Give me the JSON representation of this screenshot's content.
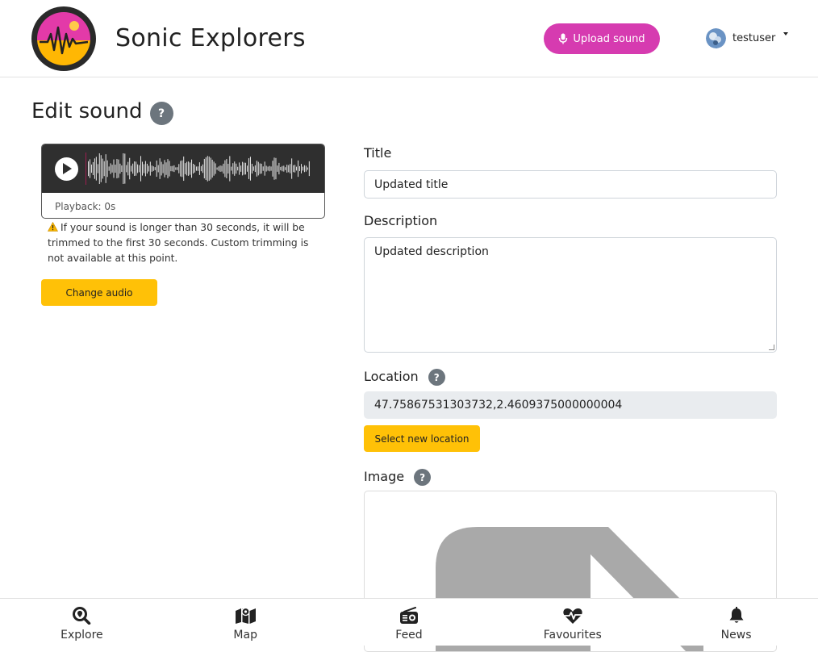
{
  "header": {
    "app_title": "Sonic Explorers",
    "upload_label": "Upload sound",
    "username": "testuser"
  },
  "page": {
    "title": "Edit sound",
    "help_label": "?"
  },
  "player": {
    "playback_text": "Playback: 0s"
  },
  "warning": {
    "text": "If your sound is longer than 30 seconds, it will be trimmed to the first 30 seconds. Custom trimming is not available at this point."
  },
  "buttons": {
    "change_audio": "Change audio",
    "select_location": "Select new location"
  },
  "form": {
    "title_label": "Title",
    "title_value": "Updated title",
    "description_label": "Description",
    "description_value": "Updated description",
    "location_label": "Location",
    "location_value": "47.75867531303732,2.4609375000000004",
    "image_label": "Image"
  },
  "nav": {
    "items": [
      {
        "label": "Explore",
        "icon": "search-location-icon"
      },
      {
        "label": "Map",
        "icon": "map-icon"
      },
      {
        "label": "Feed",
        "icon": "radio-icon"
      },
      {
        "label": "Favourites",
        "icon": "heartbeat-icon"
      },
      {
        "label": "News",
        "icon": "bell-icon"
      }
    ]
  },
  "colors": {
    "accent_pink": "#d63bb0",
    "button_yellow": "#ffc107",
    "help_gray": "#6c757d",
    "player_bg": "#2f2f2f"
  }
}
